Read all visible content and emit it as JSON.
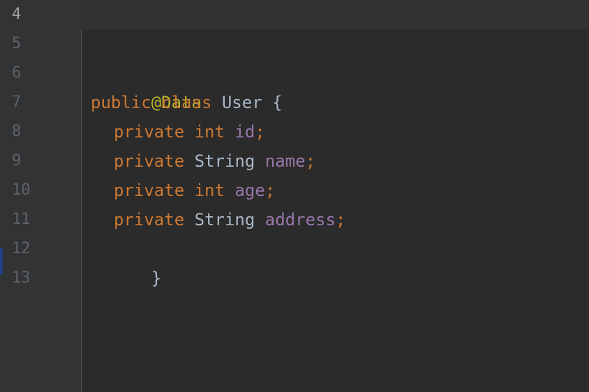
{
  "editor": {
    "colors": {
      "background": "#2b2b2b",
      "gutter": "#313335",
      "keyword": "#cc7832",
      "annotation": "#bbb529",
      "field": "#9876aa",
      "text": "#a9b7c6",
      "line_number": "#606366"
    },
    "line_numbers": [
      "4",
      "5",
      "6",
      "7",
      "8",
      "9",
      "10",
      "11",
      "12",
      "13"
    ],
    "code": {
      "annotation": "@Data",
      "kw_public": "public",
      "kw_class": "class",
      "class_name": "User",
      "open_brace": "{",
      "kw_private": "private",
      "kw_int": "int",
      "type_string": "String",
      "field_id": "id",
      "field_name": "name",
      "field_age": "age",
      "field_address": "address",
      "semicolon": ";",
      "close_brace": "}"
    }
  }
}
